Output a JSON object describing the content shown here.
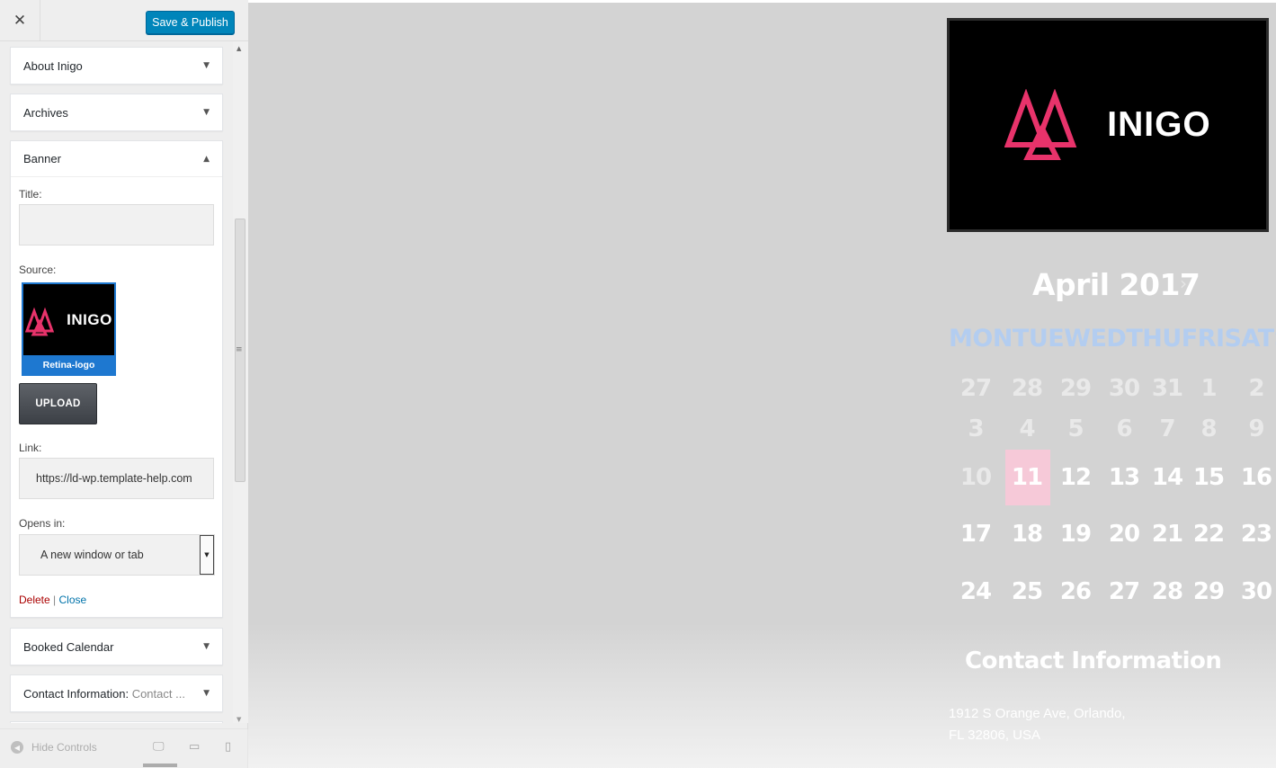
{
  "sidebar": {
    "close_icon": "close-icon",
    "save_publish": "Save & Publish",
    "widgets": {
      "about": {
        "title": "About Inigo"
      },
      "archives": {
        "title": "Archives"
      },
      "banner": {
        "title": "Banner",
        "title_label": "Title:",
        "title_value": "",
        "source_label": "Source:",
        "source_image_brand": "INIGO",
        "source_image_caption": "Retina-logo",
        "upload_label": "UPLOAD",
        "link_label": "Link:",
        "link_value": "https://ld-wp.template-help.com",
        "opens_label": "Opens in:",
        "opens_value": "A new window or tab",
        "delete_label": "Delete",
        "separator": "|",
        "close_label": "Close"
      },
      "booked": {
        "title": "Booked Calendar"
      },
      "contact": {
        "title": "Contact Information:",
        "subtitle": "Contact ..."
      }
    },
    "footer": {
      "hide_controls": "Hide Controls",
      "devices": [
        "desktop-icon",
        "tablet-icon",
        "mobile-icon"
      ]
    }
  },
  "preview": {
    "banner_brand": "INIGO",
    "brand_color": "#e8336b",
    "calendar": {
      "month_title": "April 2017",
      "next_icon": "chevron-right-icon",
      "day_headers": "MONTUEWEDTHUFRISATSUN",
      "weeks": [
        [
          "27",
          "28",
          "29",
          "30",
          "31",
          "1",
          "2"
        ],
        [
          "3",
          "4",
          "5",
          "6",
          "7",
          "8",
          "9"
        ],
        [
          "10",
          "11",
          "12",
          "13",
          "14",
          "15",
          "16"
        ],
        [
          "17",
          "18",
          "19",
          "20",
          "21",
          "22",
          "23"
        ],
        [
          "24",
          "25",
          "26",
          "27",
          "28",
          "29",
          "30"
        ]
      ],
      "today": "11",
      "today_color": "#f6c9d8"
    },
    "contact": {
      "heading": "Contact Information",
      "address_line1": "1912 S Orange Ave, Orlando,",
      "address_line2": "FL 32806, USA"
    }
  }
}
